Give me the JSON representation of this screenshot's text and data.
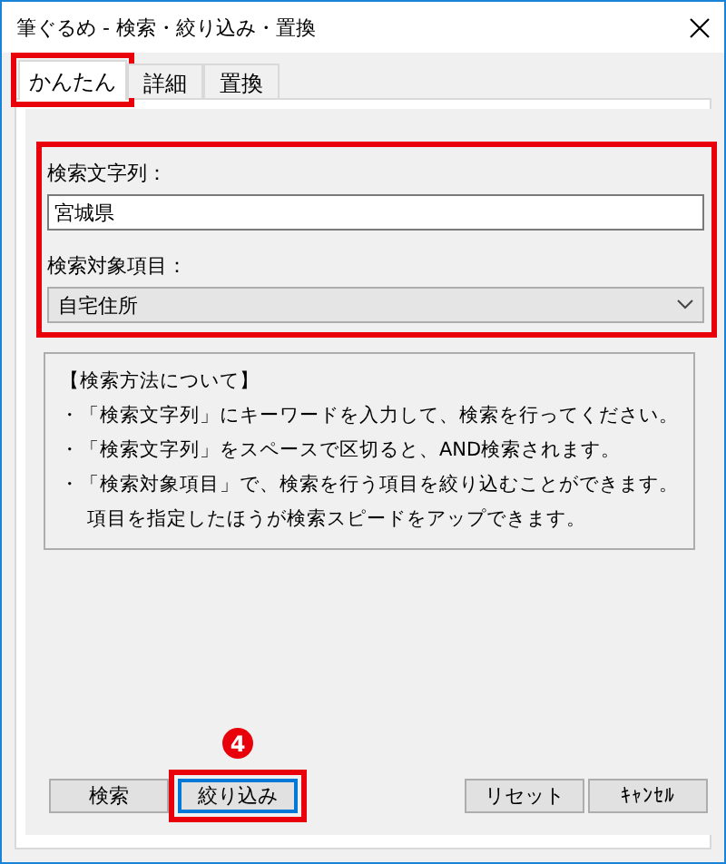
{
  "window": {
    "title": "筆ぐるめ - 検索・絞り込み・置換"
  },
  "tabs": [
    {
      "label": "かんたん",
      "selected": true,
      "highlighted": true
    },
    {
      "label": "詳細",
      "selected": false,
      "highlighted": false
    },
    {
      "label": "置換",
      "selected": false,
      "highlighted": false
    }
  ],
  "fields": {
    "highlighted": true,
    "search_label": "検索文字列：",
    "search_value": "宮城県",
    "target_label": "検索対象項目：",
    "target_value": "自宅住所"
  },
  "info": {
    "heading": "【検索方法について】",
    "notes": [
      {
        "text": "・「検索文字列」にキーワードを入力して、検索を行ってください。"
      },
      {
        "text": "・「検索文字列」をスペースで区切ると、AND検索されます。"
      },
      {
        "text": "・「検索対象項目」で、検索を行う項目を絞り込むことができます。",
        "continuation": "項目を指定したほうが検索スピードをアップできます。"
      }
    ]
  },
  "callout": "4",
  "buttons_left": [
    {
      "label": "検索",
      "focused": false,
      "highlighted": false
    },
    {
      "label": "絞り込み",
      "focused": true,
      "highlighted": true
    }
  ],
  "buttons_right": [
    {
      "label": "リセット",
      "focused": false,
      "highlighted": false
    },
    {
      "label": "ｷｬﾝｾﾙ",
      "focused": false,
      "highlighted": false
    }
  ]
}
